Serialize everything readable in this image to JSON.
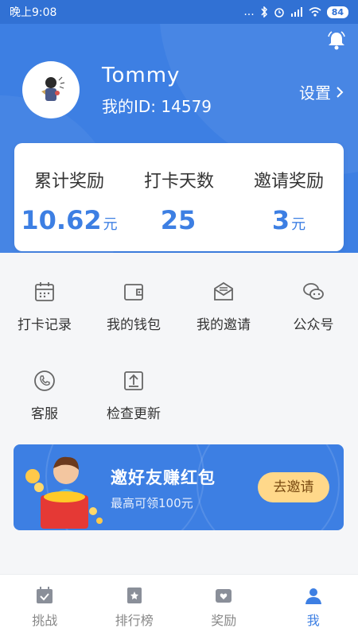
{
  "status_bar": {
    "time": "晚上9:08",
    "signal_text": "...",
    "battery": "84"
  },
  "profile": {
    "username": "Tommy",
    "user_id": "我的ID: 14579",
    "settings_label": "设置"
  },
  "stats": [
    {
      "label": "累计奖励",
      "value": "10.62",
      "unit": "元"
    },
    {
      "label": "打卡天数",
      "value": "25",
      "unit": ""
    },
    {
      "label": "邀请奖励",
      "value": "3",
      "unit": "元"
    }
  ],
  "menu": [
    {
      "label": "打卡记录",
      "icon": "calendar-icon"
    },
    {
      "label": "我的钱包",
      "icon": "wallet-icon"
    },
    {
      "label": "我的邀请",
      "icon": "envelope-icon"
    },
    {
      "label": "公众号",
      "icon": "wechat-icon"
    },
    {
      "label": "客服",
      "icon": "phone-icon"
    },
    {
      "label": "检查更新",
      "icon": "upload-icon"
    }
  ],
  "banner": {
    "title": "邀好友赚红包",
    "subtitle": "最高可领100元",
    "button": "去邀请"
  },
  "tabs": [
    {
      "label": "挑战",
      "icon": "calendar-check-icon",
      "active": false
    },
    {
      "label": "排行榜",
      "icon": "bookmark-star-icon",
      "active": false
    },
    {
      "label": "奖励",
      "icon": "wallet-heart-icon",
      "active": false
    },
    {
      "label": "我",
      "icon": "person-icon",
      "active": true
    }
  ],
  "colors": {
    "primary": "#3d7fe3",
    "status_bar": "#3171d4",
    "button_gold": "#ffd88a"
  }
}
